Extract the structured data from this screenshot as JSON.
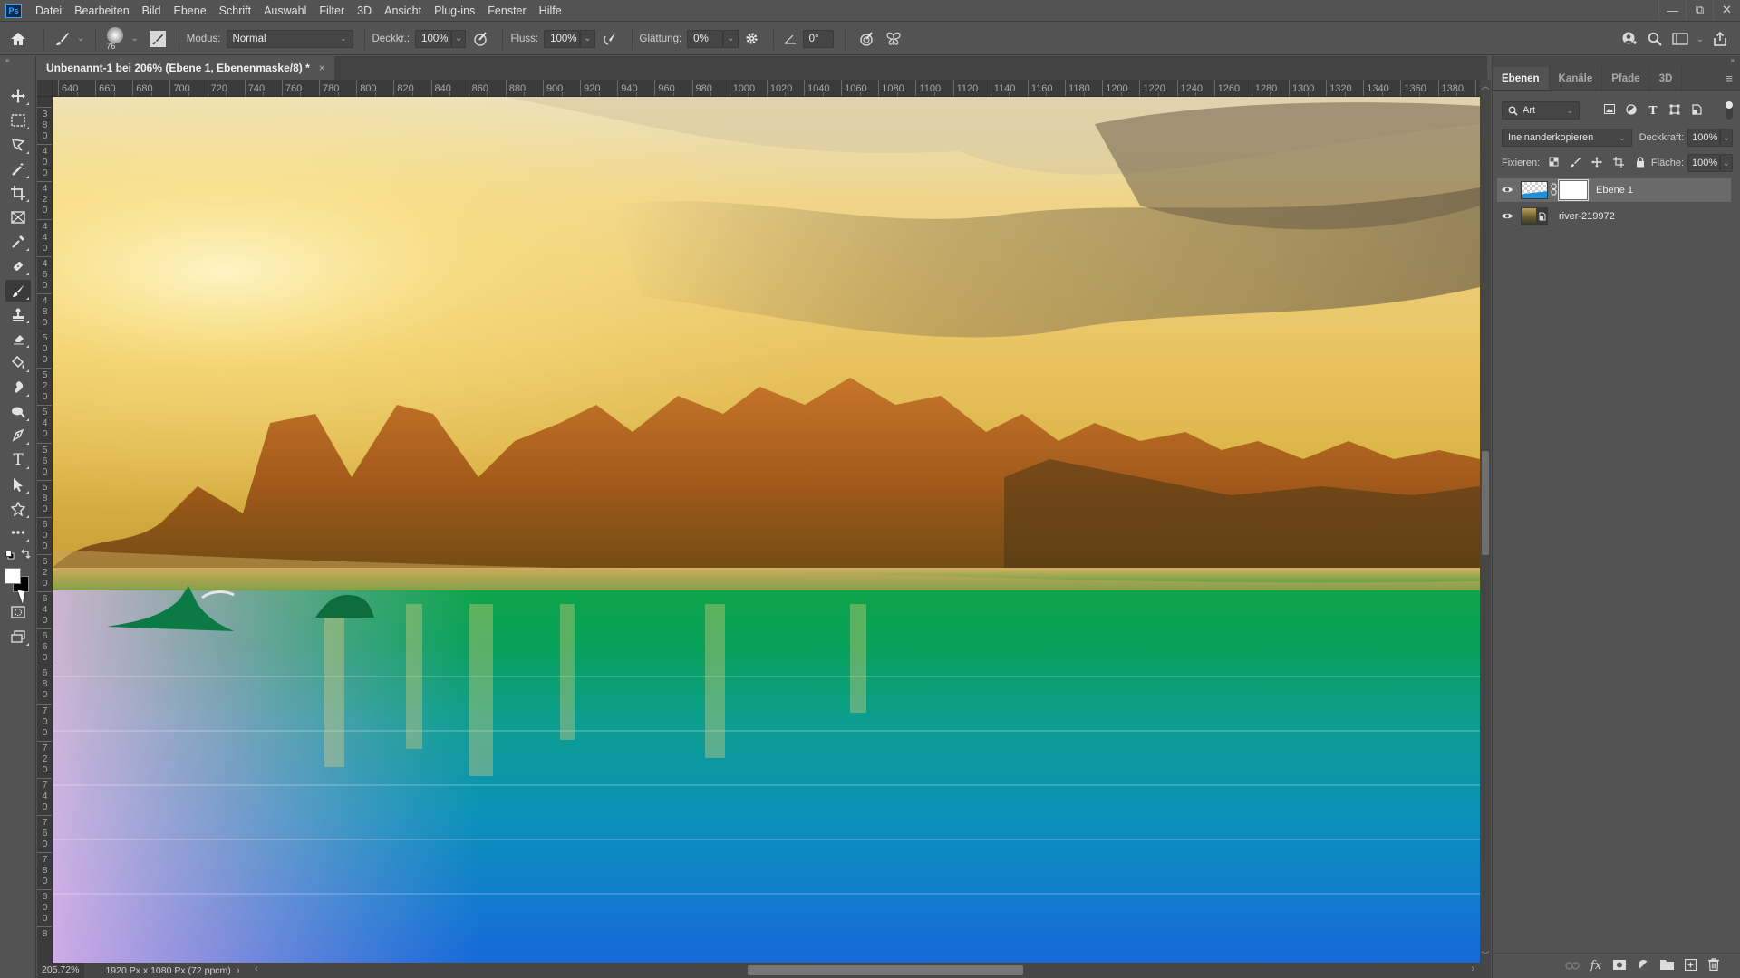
{
  "app": {
    "logo": "Ps",
    "menu": [
      "Datei",
      "Bearbeiten",
      "Bild",
      "Ebene",
      "Schrift",
      "Auswahl",
      "Filter",
      "3D",
      "Ansicht",
      "Plug-ins",
      "Fenster",
      "Hilfe"
    ],
    "window_controls": {
      "minimize": "—",
      "restore": "⧉",
      "close": "✕"
    }
  },
  "options": {
    "home_icon": "⌂",
    "tool_icon": "🖌",
    "brush_size": "76",
    "modus_label": "Modus:",
    "modus_value": "Normal",
    "deckkraft_label": "Deckkr.:",
    "deckkraft_value": "100%",
    "fluss_label": "Fluss:",
    "fluss_value": "100%",
    "glaettung_label": "Glättung:",
    "glaettung_value": "0%",
    "angle_value": "0°"
  },
  "document": {
    "tab_title": "Unbenannt-1 bei 206% (Ebene 1, Ebenenmaske/8) *",
    "close": "×"
  },
  "rulers": {
    "horizontal": [
      "640",
      "660",
      "680",
      "700",
      "720",
      "740",
      "760",
      "780",
      "800",
      "820",
      "840",
      "860",
      "880",
      "900",
      "920",
      "940",
      "960",
      "980",
      "1000",
      "1020",
      "1040",
      "1060",
      "1080",
      "1100",
      "1120",
      "1140",
      "1160",
      "1180",
      "1200",
      "1220",
      "1240",
      "1260",
      "1280",
      "1300",
      "1320",
      "1340",
      "1360",
      "1380",
      "1"
    ],
    "vertical": [
      "3",
      "380",
      "400",
      "420",
      "440",
      "460",
      "480",
      "500",
      "520",
      "540",
      "560",
      "580",
      "600",
      "620",
      "640",
      "660",
      "680",
      "700",
      "720",
      "740",
      "760",
      "780",
      "800",
      "8"
    ]
  },
  "status": {
    "zoom": "205,72%",
    "doc_size": "1920 Px x 1080 Px (72 ppcm)",
    "arrow": "›"
  },
  "panel": {
    "tabs": [
      "Ebenen",
      "Kanäle",
      "Pfade",
      "3D"
    ],
    "active_tab": "Ebenen",
    "filter_kind": "Art",
    "blend_mode": "Ineinanderkopieren",
    "deckkraft_label": "Deckkraft:",
    "deckkraft_value": "100%",
    "fixieren_label": "Fixieren:",
    "flaeche_label": "Fläche:",
    "flaeche_value": "100%",
    "layers": [
      {
        "name": "Ebene 1",
        "visible": true,
        "selected": true,
        "has_mask": true
      },
      {
        "name": "river-219972",
        "visible": true,
        "selected": false,
        "smart_object": true
      }
    ]
  }
}
